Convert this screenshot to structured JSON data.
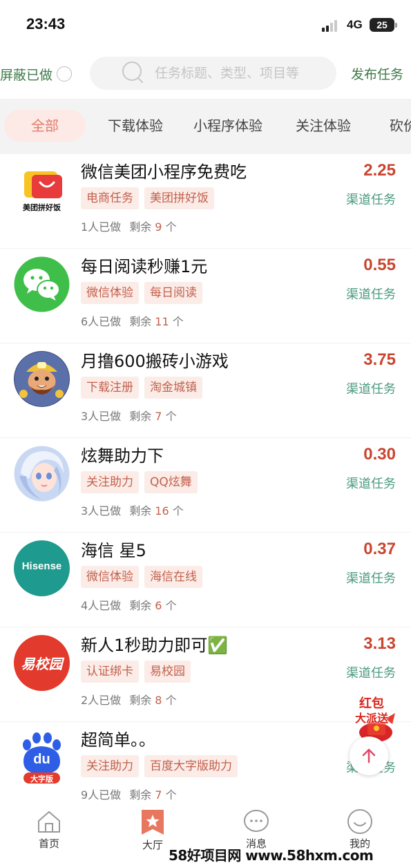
{
  "status_bar": {
    "time": "23:43",
    "network": "4G",
    "battery": "25"
  },
  "top_bar": {
    "shield_label": "屏蔽已做",
    "search_placeholder": "任务标题、类型、项目等",
    "publish_label": "发布任务"
  },
  "tabs": [
    {
      "label": "全部",
      "active": true
    },
    {
      "label": "下载体验",
      "active": false
    },
    {
      "label": "小程序体验",
      "active": false
    },
    {
      "label": "关注体验",
      "active": false
    },
    {
      "label": "砍价",
      "active": false
    }
  ],
  "tasks": [
    {
      "title": "微信美团小程序免费吃",
      "tags": [
        "电商任务",
        "美团拼好饭"
      ],
      "done_text": "1人已做",
      "remain_prefix": "剩余",
      "remain": "9",
      "remain_suffix": "个",
      "price": "2.25",
      "channel": "渠道任务",
      "icon": "meituan-pinhaofan-icon",
      "icon_text": "美团拼好饭"
    },
    {
      "title": "每日阅读秒赚1元",
      "tags": [
        "微信体验",
        "每日阅读"
      ],
      "done_text": "6人已做",
      "remain_prefix": "剩余",
      "remain": "11",
      "remain_suffix": "个",
      "price": "0.55",
      "channel": "渠道任务",
      "icon": "wechat-icon"
    },
    {
      "title": "月撸600搬砖小游戏",
      "tags": [
        "下载注册",
        "淘金城镇"
      ],
      "done_text": "3人已做",
      "remain_prefix": "剩余",
      "remain": "7",
      "remain_suffix": "个",
      "price": "3.75",
      "channel": "渠道任务",
      "icon": "gold-miner-game-icon"
    },
    {
      "title": "炫舞助力下",
      "tags": [
        "关注助力",
        "QQ炫舞"
      ],
      "done_text": "3人已做",
      "remain_prefix": "剩余",
      "remain": "16",
      "remain_suffix": "个",
      "price": "0.30",
      "channel": "渠道任务",
      "icon": "qq-dance-icon"
    },
    {
      "title": "海信 星5",
      "tags": [
        "微信体验",
        "海信在线"
      ],
      "done_text": "4人已做",
      "remain_prefix": "剩余",
      "remain": "6",
      "remain_suffix": "个",
      "price": "0.37",
      "channel": "渠道任务",
      "icon": "hisense-icon",
      "icon_text": "Hisense"
    },
    {
      "title": "新人1秒助力即可✅",
      "tags": [
        "认证绑卡",
        "易校园"
      ],
      "done_text": "2人已做",
      "remain_prefix": "剩余",
      "remain": "8",
      "remain_suffix": "个",
      "price": "3.13",
      "channel": "渠道任务",
      "icon": "yixiaoyuan-icon",
      "icon_text": "易校园"
    },
    {
      "title": "超简单。。",
      "tags": [
        "关注助力",
        "百度大字版助力"
      ],
      "done_text": "9人已做",
      "remain_prefix": "剩余",
      "remain": "7",
      "remain_suffix": "个",
      "price": "",
      "channel": "渠道任务",
      "icon": "baidu-big-font-icon",
      "icon_text": "du",
      "icon_subtext": "大字版"
    }
  ],
  "floating": {
    "red_packet_line1": "红包",
    "red_packet_line2": "大派送"
  },
  "bottom_nav": [
    {
      "label": "首页",
      "icon": "home-icon"
    },
    {
      "label": "大厅",
      "icon": "star-bookmark-icon",
      "active": true
    },
    {
      "label": "消息",
      "icon": "message-icon"
    },
    {
      "label": "我的",
      "icon": "profile-smile-icon"
    }
  ],
  "watermark": "58好项目网 www.58hxm.com",
  "colors": {
    "accent_green": "#3f7a4a",
    "price_red": "#c9452f",
    "tag_bg": "#fbece8",
    "channel_green": "#4a9a7e",
    "tab_active": "#e27b6a"
  }
}
